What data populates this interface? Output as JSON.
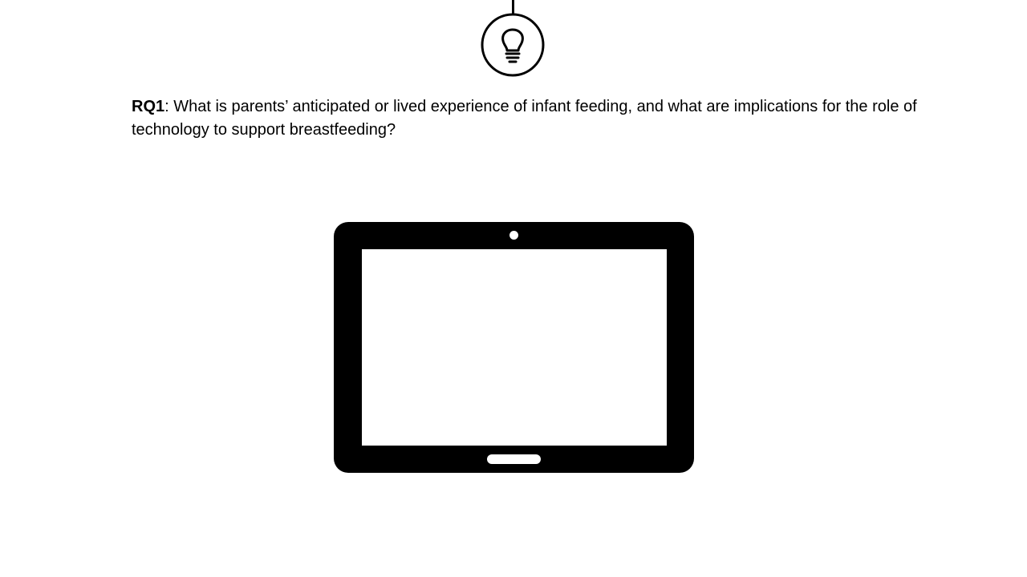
{
  "question": {
    "label": "RQ1",
    "text": ": What is parents’ anticipated or lived experience of infant feeding, and what are implications for the role of technology to support breastfeeding?"
  },
  "icons": {
    "top": "lightbulb-icon",
    "center": "tablet-icon"
  },
  "colors": {
    "background": "#ffffff",
    "foreground": "#000000"
  }
}
